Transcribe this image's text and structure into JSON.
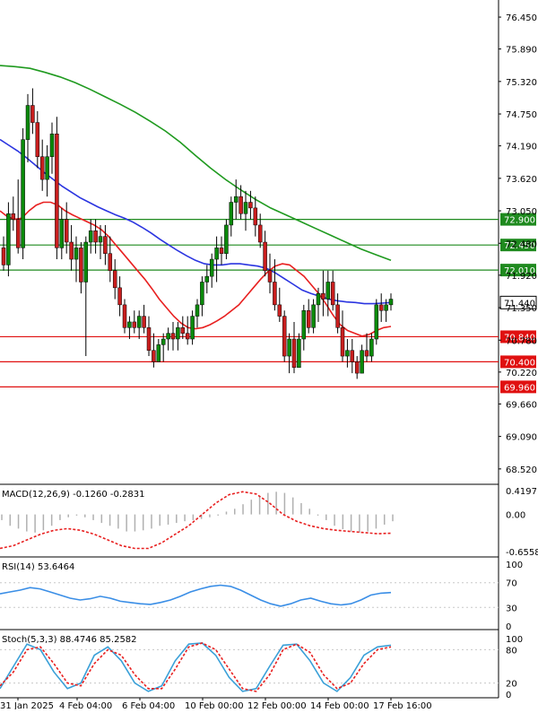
{
  "chart_data": {
    "type": "candlestick",
    "symbol_timeframe": "",
    "main_panel": {
      "ylim": [
        68.25,
        76.75
      ],
      "y_ticks": [
        "76.450",
        "75.890",
        "75.320",
        "74.750",
        "74.190",
        "73.620",
        "73.050",
        "72.480",
        "71.920",
        "71.350",
        "70.780",
        "70.220",
        "69.660",
        "69.090",
        "68.520"
      ],
      "price_labels": [
        {
          "text": "72.900",
          "value": 72.9,
          "kind": "level",
          "color": "#1f8a1f"
        },
        {
          "text": "72.450",
          "value": 72.45,
          "kind": "level",
          "color": "#1f8a1f"
        },
        {
          "text": "72.010",
          "value": 72.01,
          "kind": "level",
          "color": "#1f8a1f"
        },
        {
          "text": "71.440",
          "value": 71.44,
          "kind": "current",
          "color": "#000000"
        },
        {
          "text": "70.840",
          "value": 70.84,
          "kind": "level",
          "color": "#e01010"
        },
        {
          "text": "70.400",
          "value": 70.4,
          "kind": "level",
          "color": "#e01010"
        },
        {
          "text": "69.960",
          "value": 69.96,
          "kind": "level",
          "color": "#e01010"
        }
      ],
      "candles": [
        [
          72.4,
          72.6,
          72.0,
          72.1
        ],
        [
          72.1,
          73.2,
          71.9,
          73.0
        ],
        [
          73.0,
          73.3,
          72.7,
          72.9
        ],
        [
          72.9,
          73.6,
          72.3,
          72.4
        ],
        [
          72.4,
          74.5,
          72.2,
          74.3
        ],
        [
          74.3,
          75.1,
          73.9,
          74.9
        ],
        [
          74.9,
          75.2,
          74.4,
          74.6
        ],
        [
          74.6,
          74.8,
          73.8,
          74.0
        ],
        [
          74.0,
          74.3,
          73.4,
          73.6
        ],
        [
          73.6,
          74.2,
          73.3,
          74.0
        ],
        [
          74.0,
          74.6,
          73.7,
          74.4
        ],
        [
          74.4,
          74.7,
          72.2,
          72.4
        ],
        [
          72.4,
          73.1,
          72.2,
          72.9
        ],
        [
          72.9,
          73.2,
          72.3,
          72.5
        ],
        [
          72.5,
          72.8,
          72.0,
          72.2
        ],
        [
          72.2,
          72.6,
          71.8,
          72.4
        ],
        [
          72.4,
          72.5,
          71.6,
          71.8
        ],
        [
          71.8,
          72.6,
          70.5,
          72.5
        ],
        [
          72.5,
          72.9,
          72.3,
          72.7
        ],
        [
          72.7,
          72.9,
          72.3,
          72.5
        ],
        [
          72.5,
          72.8,
          72.2,
          72.6
        ],
        [
          72.6,
          72.8,
          72.1,
          72.3
        ],
        [
          72.3,
          72.6,
          71.8,
          72.0
        ],
        [
          72.0,
          72.2,
          71.5,
          71.7
        ],
        [
          71.7,
          71.9,
          71.2,
          71.4
        ],
        [
          71.4,
          71.5,
          70.9,
          71.0
        ],
        [
          71.0,
          71.2,
          70.8,
          71.1
        ],
        [
          71.1,
          71.3,
          70.9,
          71.0
        ],
        [
          71.0,
          71.3,
          70.8,
          71.2
        ],
        [
          71.2,
          71.4,
          70.9,
          71.0
        ],
        [
          71.0,
          71.2,
          70.5,
          70.6
        ],
        [
          70.6,
          70.9,
          70.3,
          70.4
        ],
        [
          70.4,
          70.8,
          70.4,
          70.7
        ],
        [
          70.7,
          70.9,
          70.4,
          70.8
        ],
        [
          70.8,
          71.0,
          70.6,
          70.9
        ],
        [
          70.9,
          71.1,
          70.6,
          70.8
        ],
        [
          70.8,
          71.1,
          70.6,
          71.0
        ],
        [
          71.0,
          71.2,
          70.8,
          70.9
        ],
        [
          70.9,
          71.2,
          70.7,
          70.8
        ],
        [
          70.8,
          71.3,
          70.7,
          71.2
        ],
        [
          71.2,
          71.5,
          71.0,
          71.4
        ],
        [
          71.4,
          71.9,
          71.2,
          71.8
        ],
        [
          71.8,
          72.1,
          71.6,
          71.9
        ],
        [
          71.9,
          72.3,
          71.7,
          72.2
        ],
        [
          72.2,
          72.6,
          71.8,
          72.4
        ],
        [
          72.4,
          72.6,
          72.1,
          72.3
        ],
        [
          72.3,
          72.9,
          72.2,
          72.8
        ],
        [
          72.8,
          73.3,
          72.6,
          73.2
        ],
        [
          73.2,
          73.6,
          72.9,
          73.3
        ],
        [
          73.3,
          73.5,
          72.9,
          73.0
        ],
        [
          73.0,
          73.4,
          72.7,
          73.2
        ],
        [
          73.2,
          73.4,
          72.9,
          73.1
        ],
        [
          73.1,
          73.3,
          72.6,
          72.8
        ],
        [
          72.8,
          73.0,
          72.4,
          72.5
        ],
        [
          72.5,
          72.7,
          71.9,
          72.0
        ],
        [
          72.0,
          72.3,
          71.6,
          71.8
        ],
        [
          71.8,
          72.2,
          71.3,
          71.4
        ],
        [
          71.4,
          71.7,
          71.1,
          71.2
        ],
        [
          71.2,
          71.3,
          70.4,
          70.5
        ],
        [
          70.5,
          70.9,
          70.2,
          70.8
        ],
        [
          70.8,
          71.1,
          70.2,
          70.3
        ],
        [
          70.3,
          70.9,
          70.3,
          70.8
        ],
        [
          70.8,
          71.4,
          70.6,
          71.3
        ],
        [
          71.3,
          71.5,
          70.9,
          71.0
        ],
        [
          71.0,
          71.5,
          70.9,
          71.4
        ],
        [
          71.4,
          71.7,
          71.1,
          71.6
        ],
        [
          71.6,
          72.0,
          71.2,
          71.5
        ],
        [
          71.5,
          72.0,
          71.2,
          71.8
        ],
        [
          71.8,
          72.0,
          71.3,
          71.4
        ],
        [
          71.4,
          71.6,
          70.9,
          71.0
        ],
        [
          71.0,
          71.3,
          70.4,
          70.5
        ],
        [
          70.5,
          70.8,
          70.3,
          70.6
        ],
        [
          70.6,
          70.8,
          70.2,
          70.4
        ],
        [
          70.4,
          70.5,
          70.1,
          70.2
        ],
        [
          70.2,
          70.7,
          70.2,
          70.6
        ],
        [
          70.6,
          70.9,
          70.4,
          70.5
        ],
        [
          70.5,
          70.9,
          70.4,
          70.8
        ],
        [
          70.8,
          71.5,
          70.7,
          71.4
        ],
        [
          71.4,
          71.6,
          71.1,
          71.3
        ],
        [
          71.3,
          71.5,
          71.1,
          71.4
        ],
        [
          71.4,
          71.6,
          71.3,
          71.5
        ]
      ],
      "ma_fast": [
        73.05,
        72.95,
        72.9,
        72.92,
        73.05,
        73.15,
        73.2,
        73.2,
        73.15,
        73.05,
        72.98,
        72.92,
        72.86,
        72.8,
        72.72,
        72.6,
        72.45,
        72.3,
        72.15,
        72.0,
        71.85,
        71.68,
        71.5,
        71.35,
        71.2,
        71.08,
        71.0,
        70.98,
        71.0,
        71.05,
        71.12,
        71.2,
        71.3,
        71.4,
        71.55,
        71.7,
        71.85,
        71.98,
        72.08,
        72.12,
        72.1,
        72.0,
        71.9,
        71.75,
        71.6,
        71.42,
        71.22,
        71.05,
        70.95,
        70.9,
        70.85,
        70.88,
        70.95,
        71.0,
        71.02
      ],
      "ma_mid": [
        74.3,
        74.2,
        74.1,
        73.98,
        73.85,
        73.72,
        73.6,
        73.48,
        73.38,
        73.28,
        73.2,
        73.12,
        73.05,
        72.98,
        72.92,
        72.85,
        72.76,
        72.66,
        72.55,
        72.45,
        72.35,
        72.26,
        72.18,
        72.12,
        72.1,
        72.1,
        72.12,
        72.12,
        72.1,
        72.08,
        72.04,
        71.96,
        71.86,
        71.76,
        71.66,
        71.6,
        71.55,
        71.5,
        71.47,
        71.45,
        71.44,
        71.42,
        71.42,
        71.43,
        71.44
      ],
      "ma_slow": [
        75.6,
        75.58,
        75.55,
        75.48,
        75.4,
        75.3,
        75.18,
        75.05,
        74.92,
        74.78,
        74.62,
        74.45,
        74.25,
        74.02,
        73.8,
        73.6,
        73.42,
        73.25,
        73.1,
        72.98,
        72.86,
        72.74,
        72.62,
        72.5,
        72.38,
        72.28,
        72.18
      ]
    },
    "macd_panel": {
      "label": "MACD(12,26,9) -0.1260 -0.2831",
      "ylim": [
        -0.75,
        0.5
      ],
      "y_ticks": [
        "0.4197",
        "0.00",
        "-0.6558"
      ],
      "histogram": [
        -0.1,
        -0.2,
        -0.25,
        -0.3,
        -0.32,
        -0.28,
        -0.2,
        -0.1,
        -0.05,
        -0.02,
        -0.05,
        -0.1,
        -0.15,
        -0.2,
        -0.25,
        -0.3,
        -0.3,
        -0.28,
        -0.25,
        -0.2,
        -0.18,
        -0.15,
        -0.12,
        -0.1,
        -0.08,
        -0.05,
        -0.02,
        0.05,
        0.1,
        0.18,
        0.26,
        0.32,
        0.38,
        0.4,
        0.38,
        0.3,
        0.2,
        0.1,
        -0.02,
        -0.1,
        -0.2,
        -0.26,
        -0.3,
        -0.32,
        -0.3,
        -0.25,
        -0.18,
        -0.12
      ],
      "signal": [
        -0.6,
        -0.55,
        -0.45,
        -0.35,
        -0.28,
        -0.25,
        -0.28,
        -0.35,
        -0.45,
        -0.55,
        -0.6,
        -0.6,
        -0.5,
        -0.35,
        -0.2,
        0.0,
        0.2,
        0.35,
        0.4,
        0.36,
        0.2,
        0.0,
        -0.12,
        -0.2,
        -0.25,
        -0.28,
        -0.3,
        -0.32,
        -0.34,
        -0.33
      ]
    },
    "rsi_panel": {
      "label": "RSI(14) 53.6464",
      "ylim": [
        0,
        100
      ],
      "y_ticks": [
        "100",
        "70",
        "30",
        "0"
      ],
      "values": [
        52,
        55,
        58,
        62,
        60,
        55,
        50,
        45,
        42,
        44,
        48,
        45,
        40,
        38,
        36,
        35,
        38,
        42,
        48,
        55,
        60,
        64,
        66,
        64,
        58,
        50,
        42,
        36,
        32,
        36,
        42,
        45,
        40,
        36,
        34,
        36,
        42,
        50,
        53,
        54
      ]
    },
    "stoch_panel": {
      "label": "Stoch(5,3,3) 88.4746 85.2582",
      "ylim": [
        0,
        100
      ],
      "y_ticks": [
        "100",
        "80",
        "20",
        "0"
      ],
      "k": [
        10,
        50,
        90,
        80,
        40,
        10,
        20,
        70,
        85,
        60,
        20,
        5,
        15,
        60,
        90,
        92,
        70,
        30,
        5,
        10,
        50,
        88,
        90,
        60,
        20,
        5,
        30,
        70,
        85,
        88
      ],
      "d": [
        15,
        40,
        80,
        85,
        55,
        20,
        15,
        55,
        80,
        70,
        35,
        10,
        10,
        45,
        85,
        92,
        80,
        45,
        10,
        5,
        35,
        80,
        90,
        75,
        35,
        10,
        20,
        55,
        80,
        85
      ]
    },
    "time_labels": [
      "31 Jan 2025",
      "4 Feb 04:00",
      "6 Feb 04:00",
      "10 Feb 00:00",
      "12 Feb 00:00",
      "14 Feb 00:00",
      "17 Feb 16:00"
    ]
  }
}
